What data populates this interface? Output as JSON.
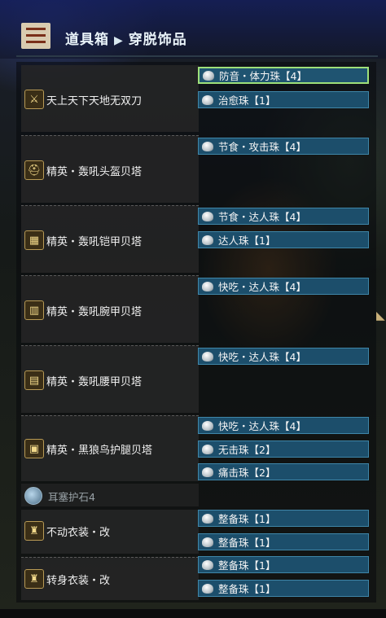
{
  "header": {
    "title": "道具箱",
    "subtitle": "穿脱饰品"
  },
  "gear": [
    {
      "name": "天上天下天地无双刀",
      "icon": "great-sword-icon",
      "glyph": "⚔"
    },
    {
      "name": "精英・轰吼头盔贝塔",
      "icon": "helm-icon",
      "glyph": "⛑"
    },
    {
      "name": "精英・轰吼铠甲贝塔",
      "icon": "chest-icon",
      "glyph": "▦"
    },
    {
      "name": "精英・轰吼腕甲贝塔",
      "icon": "arm-icon",
      "glyph": "▥"
    },
    {
      "name": "精英・轰吼腰甲贝塔",
      "icon": "waist-icon",
      "glyph": "▤"
    },
    {
      "name": "精英・黑狼鸟护腿贝塔",
      "icon": "legs-icon",
      "glyph": "▣"
    },
    {
      "name": "不动衣装・改",
      "icon": "mantle-icon",
      "glyph": "♜"
    },
    {
      "name": "转身衣装・改",
      "icon": "mantle-icon",
      "glyph": "♜"
    }
  ],
  "charm": {
    "name": "耳塞护石4",
    "icon": "charm-icon"
  },
  "slots": [
    "防音・体力珠【4】",
    "治愈珠【1】",
    "节食・攻击珠【4】",
    "节食・达人珠【4】",
    "达人珠【1】",
    "快吃・达人珠【4】",
    "快吃・达人珠【4】",
    "快吃・达人珠【4】",
    "无击珠【2】",
    "痛击珠【2】",
    "整备珠【1】",
    "整备珠【1】",
    "整备珠【1】",
    "整备珠【1】"
  ],
  "colors": {
    "slot_bg": "#1c4e6b",
    "slot_border": "#3f86a8",
    "selected_border": "#9ee07a"
  }
}
